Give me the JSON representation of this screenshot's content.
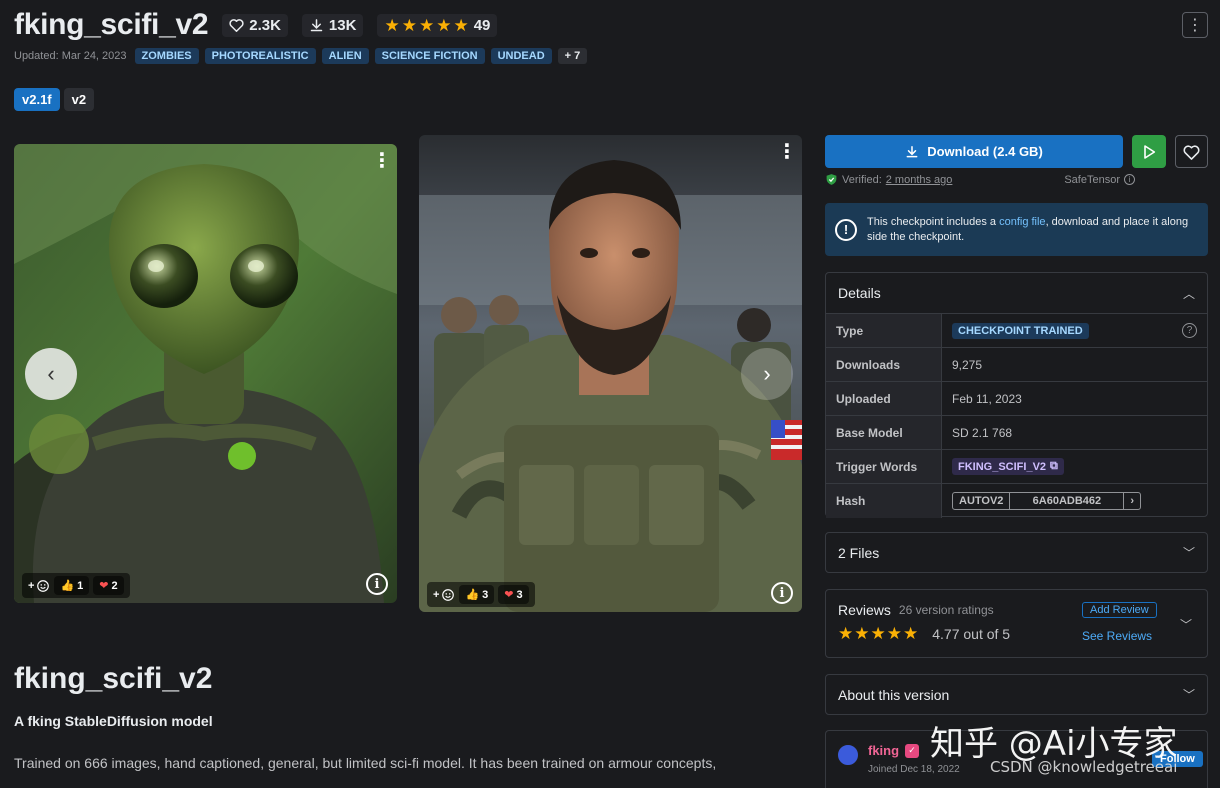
{
  "header": {
    "title": "fking_scifi_v2",
    "likes": "2.3K",
    "downloads": "13K",
    "rating_count": "49",
    "updated": "Updated: Mar 24, 2023",
    "tags": [
      "ZOMBIES",
      "PHOTOREALISTIC",
      "ALIEN",
      "SCIENCE FICTION",
      "UNDEAD"
    ],
    "more_tags": "+ 7"
  },
  "versions": [
    "v2.1f",
    "v2"
  ],
  "gallery": {
    "image1": {
      "reactions": {
        "like": "1",
        "heart": "2"
      }
    },
    "image2": {
      "reactions": {
        "like": "3",
        "heart": "3"
      }
    }
  },
  "body": {
    "title": "fking_scifi_v2",
    "subtitle": "A fking StableDiffusion model",
    "description": "Trained on 666 images, hand captioned, general, but limited sci-fi model. It has been trained on armour concepts,"
  },
  "sidebar": {
    "download_label": "Download (2.4 GB)",
    "verified_label": "Verified:",
    "verified_time": "2 months ago",
    "safetensor": "SafeTensor",
    "alert": {
      "text_before": "This checkpoint includes a ",
      "link": "config file",
      "text_after": ", download and place it along side the checkpoint."
    },
    "details": {
      "heading": "Details",
      "rows": {
        "type_label": "Type",
        "type_value": "CHECKPOINT TRAINED",
        "downloads_label": "Downloads",
        "downloads_value": "9,275",
        "uploaded_label": "Uploaded",
        "uploaded_value": "Feb 11, 2023",
        "base_label": "Base Model",
        "base_value": "SD 2.1 768",
        "trigger_label": "Trigger Words",
        "trigger_value": "FKING_SCIFI_V2",
        "hash_label": "Hash",
        "hash_type": "AUTOV2",
        "hash_value": "6A60ADB462"
      }
    },
    "files_heading": "2 Files",
    "reviews": {
      "label": "Reviews",
      "count": "26 version ratings",
      "score": "4.77 out of 5",
      "add": "Add Review",
      "see": "See Reviews"
    },
    "about_heading": "About this version",
    "author": {
      "name": "fking",
      "joined": "Joined Dec 18, 2022",
      "follow": "Follow"
    }
  },
  "watermark": {
    "line1": "知乎 @Ai小专家",
    "line2": "CSDN @knowledgetreeai"
  },
  "colors": {
    "accent": "#1971c2",
    "star": "#fab005",
    "play": "#2f9e44",
    "author": "#f06595"
  }
}
